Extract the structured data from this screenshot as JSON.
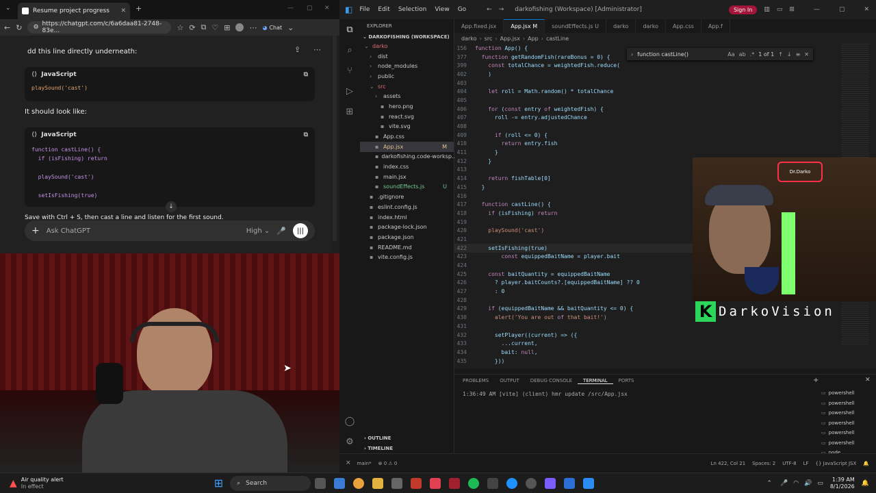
{
  "browser": {
    "tab_title": "Resume project progress",
    "url": "https://chatgpt.com/c/6a6daa81-2748-83e...",
    "chat_button": "Chat"
  },
  "chat": {
    "intro_line": "dd this line directly underneath:",
    "code1": {
      "lang": "JavaScript",
      "lines": [
        "playSound('cast')"
      ]
    },
    "look_like": "It should look like:",
    "code2": {
      "lang": "JavaScript",
      "lines": [
        "function castLine() {",
        "  if (isFishing) return",
        "",
        "  playSound('cast')",
        "",
        "  setIsFishing(true)"
      ]
    },
    "save_line": "Save with Ctrl + S, then cast a line and listen for the first sound.",
    "composer_placeholder": "Ask ChatGPT",
    "model_level": "High"
  },
  "vscode": {
    "menu": [
      "File",
      "Edit",
      "Selection",
      "View",
      "Go"
    ],
    "title": "darkofishing (Workspace) [Administrator]",
    "sign_in": "Sign In",
    "explorer_title": "EXPLORER",
    "workspace": "DARKOFISHING (WORKSPACE)",
    "tree": [
      {
        "name": "darko",
        "depth": 0,
        "kind": "folder-open",
        "color": "#e06c75"
      },
      {
        "name": "dist",
        "depth": 1,
        "kind": "folder",
        "color": "#ccc"
      },
      {
        "name": "node_modules",
        "depth": 1,
        "kind": "folder",
        "color": "#ccc"
      },
      {
        "name": "public",
        "depth": 1,
        "kind": "folder",
        "color": "#ccc"
      },
      {
        "name": "src",
        "depth": 1,
        "kind": "folder-open",
        "color": "#e06c75"
      },
      {
        "name": "assets",
        "depth": 2,
        "kind": "folder",
        "color": "#ccc"
      },
      {
        "name": "hero.png",
        "depth": 3,
        "kind": "file",
        "color": "#ccc"
      },
      {
        "name": "react.svg",
        "depth": 3,
        "kind": "file",
        "color": "#ccc"
      },
      {
        "name": "vite.svg",
        "depth": 3,
        "kind": "file",
        "color": "#ccc"
      },
      {
        "name": "App.css",
        "depth": 2,
        "kind": "file",
        "color": "#ccc"
      },
      {
        "name": "App.jsx",
        "depth": 2,
        "kind": "file",
        "color": "#e2c08d",
        "badge": "M"
      },
      {
        "name": "darkofishing.code-worksp...",
        "depth": 2,
        "kind": "file",
        "color": "#ccc"
      },
      {
        "name": "index.css",
        "depth": 2,
        "kind": "file",
        "color": "#ccc"
      },
      {
        "name": "main.jsx",
        "depth": 2,
        "kind": "file",
        "color": "#ccc"
      },
      {
        "name": "soundEffects.js",
        "depth": 2,
        "kind": "file",
        "color": "#73c991",
        "badge": "U"
      },
      {
        "name": ".gitignore",
        "depth": 1,
        "kind": "file",
        "color": "#ccc"
      },
      {
        "name": "eslint.config.js",
        "depth": 1,
        "kind": "file",
        "color": "#ccc"
      },
      {
        "name": "index.html",
        "depth": 1,
        "kind": "file",
        "color": "#ccc"
      },
      {
        "name": "package-lock.json",
        "depth": 1,
        "kind": "file",
        "color": "#ccc"
      },
      {
        "name": "package.json",
        "depth": 1,
        "kind": "file",
        "color": "#ccc"
      },
      {
        "name": "README.md",
        "depth": 1,
        "kind": "file",
        "color": "#ccc"
      },
      {
        "name": "vite.config.js",
        "depth": 1,
        "kind": "file",
        "color": "#ccc"
      }
    ],
    "outline": "OUTLINE",
    "timeline": "TIMELINE",
    "tabs": [
      {
        "label": "App.fixed.jsx",
        "active": false
      },
      {
        "label": "App.jsx M",
        "active": true
      },
      {
        "label": "soundEffects.js U",
        "active": false
      },
      {
        "label": "darko",
        "active": false
      },
      {
        "label": "darko",
        "active": false
      },
      {
        "label": "App.css",
        "active": false
      },
      {
        "label": "App.f",
        "active": false
      }
    ],
    "breadcrumbs": [
      "darko",
      "src",
      "App.jsx",
      "App",
      "castLine"
    ],
    "find_query": "function castLine()",
    "find_result": "1 of 1",
    "code": [
      {
        "n": "156",
        "t": "function App() {"
      },
      {
        "n": "377",
        "t": "  function getRandomFish(rareBonus = 0) {"
      },
      {
        "n": "399",
        "t": "    const totalChance = weightedFish.reduce("
      },
      {
        "n": "402",
        "t": "    )"
      },
      {
        "n": "403",
        "t": ""
      },
      {
        "n": "404",
        "t": "    let roll = Math.random() * totalChance"
      },
      {
        "n": "405",
        "t": ""
      },
      {
        "n": "406",
        "t": "    for (const entry of weightedFish) {"
      },
      {
        "n": "407",
        "t": "      roll -= entry.adjustedChance"
      },
      {
        "n": "408",
        "t": ""
      },
      {
        "n": "409",
        "t": "      if (roll <= 0) {"
      },
      {
        "n": "410",
        "t": "        return entry.fish"
      },
      {
        "n": "411",
        "t": "      }"
      },
      {
        "n": "412",
        "t": "    }"
      },
      {
        "n": "413",
        "t": ""
      },
      {
        "n": "414",
        "t": "    return fishTable[0]"
      },
      {
        "n": "415",
        "t": "  }"
      },
      {
        "n": "416",
        "t": ""
      },
      {
        "n": "417",
        "t": "  function castLine() {"
      },
      {
        "n": "418",
        "t": "    if (isFishing) return"
      },
      {
        "n": "419",
        "t": ""
      },
      {
        "n": "420",
        "t": "    playSound('cast')"
      },
      {
        "n": "421",
        "t": ""
      },
      {
        "n": "422",
        "t": "    setIsFishing(true)"
      },
      {
        "n": "423",
        "t": "        const equippedBaitName = player.bait"
      },
      {
        "n": "424",
        "t": ""
      },
      {
        "n": "425",
        "t": "    const baitQuantity = equippedBaitName"
      },
      {
        "n": "426",
        "t": "      ? player.baitCounts?.[equippedBaitName] ?? 0"
      },
      {
        "n": "427",
        "t": "      : 0"
      },
      {
        "n": "428",
        "t": ""
      },
      {
        "n": "429",
        "t": "    if (equippedBaitName && baitQuantity <= 0) {"
      },
      {
        "n": "430",
        "t": "      alert('You are out of that bait!')"
      },
      {
        "n": "431",
        "t": ""
      },
      {
        "n": "432",
        "t": "      setPlayer((current) => ({"
      },
      {
        "n": "433",
        "t": "        ...current,"
      },
      {
        "n": "434",
        "t": "        bait: null,"
      },
      {
        "n": "435",
        "t": "      }))"
      }
    ],
    "panel_tabs": [
      "PROBLEMS",
      "OUTPUT",
      "DEBUG CONSOLE",
      "TERMINAL",
      "PORTS"
    ],
    "terminal_line": "1:36:49 AM [vite] (client) hmr update /src/App.jsx",
    "terminals": [
      "powershell",
      "powershell",
      "powershell",
      "powershell",
      "powershell",
      "powershell",
      "node"
    ],
    "status_left": [
      "main*",
      "⊗ 0 ⚠ 0"
    ],
    "status_right": [
      "Ln 422, Col 21",
      "Spaces: 2",
      "UTF-8",
      "LF",
      "{} JavaScript JSX"
    ]
  },
  "overlay": {
    "brand": "DarkoVision"
  },
  "taskbar": {
    "alert_title": "Air quality alert",
    "alert_sub": "In effect",
    "search": "Search",
    "time": "1:39 AM",
    "date": "8/1/2026"
  }
}
